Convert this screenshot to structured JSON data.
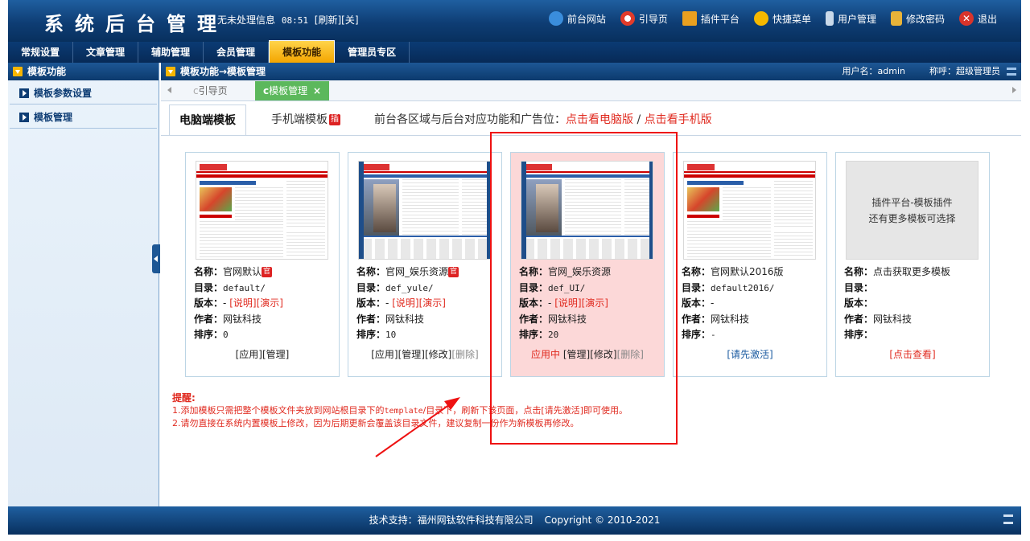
{
  "header": {
    "title": "系统后台管理",
    "message": "无未处理信息",
    "time": "08:51",
    "refresh": "[刷新]",
    "close": "[关]",
    "links": [
      {
        "label": "前台网站",
        "icon": "globe-icon",
        "color": "#3a8ddc"
      },
      {
        "label": "引导页",
        "icon": "lifebuoy-icon",
        "color": "#e23b2a"
      },
      {
        "label": "插件平台",
        "icon": "store-icon",
        "color": "#e9a020"
      },
      {
        "label": "快捷菜单",
        "icon": "circle-icon",
        "color": "#f5b800"
      },
      {
        "label": "用户管理",
        "icon": "user-icon",
        "color": "#c9d9ea"
      },
      {
        "label": "修改密码",
        "icon": "lock-icon",
        "color": "#e8b339"
      },
      {
        "label": "退出",
        "icon": "close-circle-icon",
        "color": "#d9342b"
      }
    ]
  },
  "nav": [
    "常规设置",
    "文章管理",
    "辅助管理",
    "会员管理",
    "模板功能",
    "管理员专区"
  ],
  "nav_active_index": 4,
  "left_panel": {
    "title": "模板功能",
    "items": [
      "模板参数设置",
      "模板管理"
    ]
  },
  "right_panel": {
    "breadcrumb": "模板功能→模板管理",
    "username_label": "用户名：admin",
    "role_label": "称呼：超级管理员"
  },
  "tabs": {
    "home": "引导页",
    "current": "模板管理",
    "close": "×"
  },
  "subtabs": {
    "pc": "电脑端模板",
    "mobile": "手机端模板",
    "mobile_badge": "插",
    "info_prefix": "前台各区域与后台对应功能和广告位：",
    "pc_link": "点击看电脑版",
    "sep": " / ",
    "mobile_link": "点击看手机版"
  },
  "labels": {
    "name": "名称：",
    "dir": "目录：",
    "version": "版本：",
    "author": "作者：",
    "order": "排序："
  },
  "cards": [
    {
      "name": "官网默认",
      "official": "官",
      "dir": "default/",
      "version": "-",
      "doc": "[说明]",
      "demo": "[演示]",
      "author": "网钛科技",
      "order": "0",
      "actions": {
        "apply": "[应用]",
        "manage": "[管理]"
      }
    },
    {
      "name": "官网_娱乐资源",
      "official": "官",
      "dir": "def_yule/",
      "version": "-",
      "doc": "[说明]",
      "demo": "[演示]",
      "author": "网钛科技",
      "order": "10",
      "actions": {
        "apply": "[应用]",
        "manage": "[管理]",
        "edit": "[修改]",
        "delete": "[删除]"
      }
    },
    {
      "name": "官网_娱乐资源",
      "dir": "def_UI/",
      "version": "-",
      "doc": "[说明]",
      "demo": "[演示]",
      "author": "网钛科技",
      "order": "20",
      "actions": {
        "status": "应用中",
        "manage": "[管理]",
        "edit": "[修改]",
        "delete": "[删除]"
      }
    },
    {
      "name": "官网默认2016版",
      "dir": "default2016/",
      "version": "-",
      "author": "网钛科技",
      "order": "-",
      "actions": {
        "activate": "[请先激活]"
      }
    },
    {
      "name": "点击获取更多模板",
      "placeholder_line1": "插件平台-模板插件",
      "placeholder_line2": "还有更多模板可选择",
      "author": "网钛科技",
      "actions": {
        "view": "[点击查看]"
      }
    }
  ],
  "notes": {
    "title": "提醒:",
    "line1_a": "1.添加模板只需把整个模板文件夹放到网站根目录下的",
    "line1_code": "template",
    "line1_b": "/目录下，刷新下该页面，点击[请先激活]即可使用。",
    "line2": "2.请勿直接在系统内置模板上修改，因为后期更新会覆盖该目录文件，建议复制一份作为新模板再修改。"
  },
  "footer": {
    "support": "技术支持：福州网钛软件科技有限公司",
    "copyright": "Copyright © 2010-2021"
  },
  "colors": {
    "header": "#0e3d74",
    "active_tab": "#f4a500",
    "current_tab": "#5cb85c",
    "link_red": "#e02b20",
    "highlight_card": "#fcd8d8",
    "annotation": "#ee1111"
  }
}
